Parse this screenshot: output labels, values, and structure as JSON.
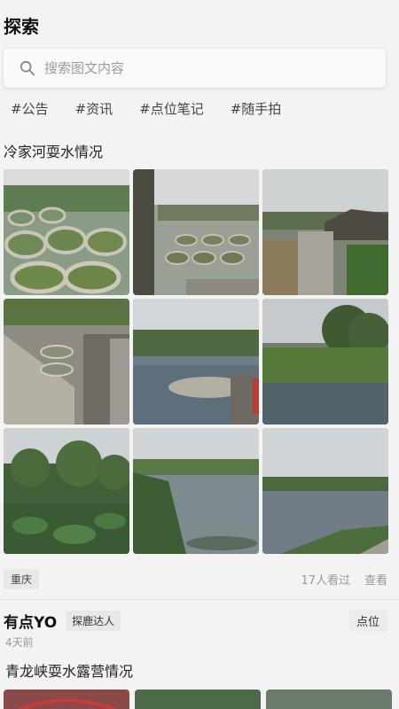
{
  "page": {
    "title": "探索"
  },
  "search": {
    "placeholder": "搜索图文内容"
  },
  "tags": [
    "#公告",
    "#资讯",
    "#点位笔记",
    "#随手拍"
  ],
  "post1": {
    "title": "冷家河耍水情况",
    "location": "重庆",
    "views": "17人看过",
    "view_link": "查看"
  },
  "post2": {
    "author": "有点YO",
    "badge": "探鹿达人",
    "place_button": "点位",
    "time": "4天前",
    "title": "青龙峡耍水露营情况"
  },
  "colors": {
    "background": "#f3f3f3",
    "chip": "#e8e8e8",
    "muted": "#999999"
  }
}
